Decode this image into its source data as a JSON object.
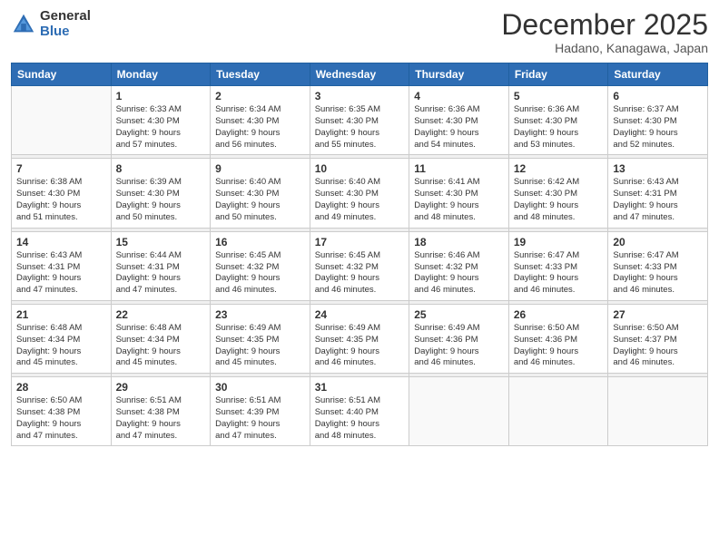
{
  "header": {
    "logo_general": "General",
    "logo_blue": "Blue",
    "month_title": "December 2025",
    "subtitle": "Hadano, Kanagawa, Japan"
  },
  "days_of_week": [
    "Sunday",
    "Monday",
    "Tuesday",
    "Wednesday",
    "Thursday",
    "Friday",
    "Saturday"
  ],
  "weeks": [
    [
      {
        "day": "",
        "info": ""
      },
      {
        "day": "1",
        "info": "Sunrise: 6:33 AM\nSunset: 4:30 PM\nDaylight: 9 hours\nand 57 minutes."
      },
      {
        "day": "2",
        "info": "Sunrise: 6:34 AM\nSunset: 4:30 PM\nDaylight: 9 hours\nand 56 minutes."
      },
      {
        "day": "3",
        "info": "Sunrise: 6:35 AM\nSunset: 4:30 PM\nDaylight: 9 hours\nand 55 minutes."
      },
      {
        "day": "4",
        "info": "Sunrise: 6:36 AM\nSunset: 4:30 PM\nDaylight: 9 hours\nand 54 minutes."
      },
      {
        "day": "5",
        "info": "Sunrise: 6:36 AM\nSunset: 4:30 PM\nDaylight: 9 hours\nand 53 minutes."
      },
      {
        "day": "6",
        "info": "Sunrise: 6:37 AM\nSunset: 4:30 PM\nDaylight: 9 hours\nand 52 minutes."
      }
    ],
    [
      {
        "day": "7",
        "info": "Sunrise: 6:38 AM\nSunset: 4:30 PM\nDaylight: 9 hours\nand 51 minutes."
      },
      {
        "day": "8",
        "info": "Sunrise: 6:39 AM\nSunset: 4:30 PM\nDaylight: 9 hours\nand 50 minutes."
      },
      {
        "day": "9",
        "info": "Sunrise: 6:40 AM\nSunset: 4:30 PM\nDaylight: 9 hours\nand 50 minutes."
      },
      {
        "day": "10",
        "info": "Sunrise: 6:40 AM\nSunset: 4:30 PM\nDaylight: 9 hours\nand 49 minutes."
      },
      {
        "day": "11",
        "info": "Sunrise: 6:41 AM\nSunset: 4:30 PM\nDaylight: 9 hours\nand 48 minutes."
      },
      {
        "day": "12",
        "info": "Sunrise: 6:42 AM\nSunset: 4:30 PM\nDaylight: 9 hours\nand 48 minutes."
      },
      {
        "day": "13",
        "info": "Sunrise: 6:43 AM\nSunset: 4:31 PM\nDaylight: 9 hours\nand 47 minutes."
      }
    ],
    [
      {
        "day": "14",
        "info": "Sunrise: 6:43 AM\nSunset: 4:31 PM\nDaylight: 9 hours\nand 47 minutes."
      },
      {
        "day": "15",
        "info": "Sunrise: 6:44 AM\nSunset: 4:31 PM\nDaylight: 9 hours\nand 47 minutes."
      },
      {
        "day": "16",
        "info": "Sunrise: 6:45 AM\nSunset: 4:32 PM\nDaylight: 9 hours\nand 46 minutes."
      },
      {
        "day": "17",
        "info": "Sunrise: 6:45 AM\nSunset: 4:32 PM\nDaylight: 9 hours\nand 46 minutes."
      },
      {
        "day": "18",
        "info": "Sunrise: 6:46 AM\nSunset: 4:32 PM\nDaylight: 9 hours\nand 46 minutes."
      },
      {
        "day": "19",
        "info": "Sunrise: 6:47 AM\nSunset: 4:33 PM\nDaylight: 9 hours\nand 46 minutes."
      },
      {
        "day": "20",
        "info": "Sunrise: 6:47 AM\nSunset: 4:33 PM\nDaylight: 9 hours\nand 46 minutes."
      }
    ],
    [
      {
        "day": "21",
        "info": "Sunrise: 6:48 AM\nSunset: 4:34 PM\nDaylight: 9 hours\nand 45 minutes."
      },
      {
        "day": "22",
        "info": "Sunrise: 6:48 AM\nSunset: 4:34 PM\nDaylight: 9 hours\nand 45 minutes."
      },
      {
        "day": "23",
        "info": "Sunrise: 6:49 AM\nSunset: 4:35 PM\nDaylight: 9 hours\nand 45 minutes."
      },
      {
        "day": "24",
        "info": "Sunrise: 6:49 AM\nSunset: 4:35 PM\nDaylight: 9 hours\nand 46 minutes."
      },
      {
        "day": "25",
        "info": "Sunrise: 6:49 AM\nSunset: 4:36 PM\nDaylight: 9 hours\nand 46 minutes."
      },
      {
        "day": "26",
        "info": "Sunrise: 6:50 AM\nSunset: 4:36 PM\nDaylight: 9 hours\nand 46 minutes."
      },
      {
        "day": "27",
        "info": "Sunrise: 6:50 AM\nSunset: 4:37 PM\nDaylight: 9 hours\nand 46 minutes."
      }
    ],
    [
      {
        "day": "28",
        "info": "Sunrise: 6:50 AM\nSunset: 4:38 PM\nDaylight: 9 hours\nand 47 minutes."
      },
      {
        "day": "29",
        "info": "Sunrise: 6:51 AM\nSunset: 4:38 PM\nDaylight: 9 hours\nand 47 minutes."
      },
      {
        "day": "30",
        "info": "Sunrise: 6:51 AM\nSunset: 4:39 PM\nDaylight: 9 hours\nand 47 minutes."
      },
      {
        "day": "31",
        "info": "Sunrise: 6:51 AM\nSunset: 4:40 PM\nDaylight: 9 hours\nand 48 minutes."
      },
      {
        "day": "",
        "info": ""
      },
      {
        "day": "",
        "info": ""
      },
      {
        "day": "",
        "info": ""
      }
    ]
  ]
}
